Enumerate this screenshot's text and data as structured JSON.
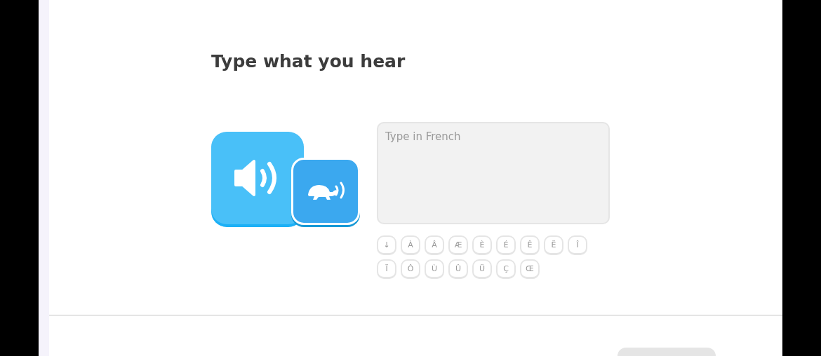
{
  "prompt": {
    "title": "Type what you hear"
  },
  "audio": {
    "normal_button": {
      "selected": false
    },
    "slow_button": {
      "selected": false
    }
  },
  "answer": {
    "placeholder": "Type in French"
  },
  "accent_keys": [
    [
      "↓",
      "À",
      "Â",
      "Æ",
      "È",
      "É",
      "Ê",
      "Ë",
      "Î"
    ],
    [
      "Ï",
      "Ô",
      "Ù",
      "Û",
      "Ü",
      "Ç",
      "Œ"
    ]
  ],
  "footer": {
    "check_button": {
      "disabled": true
    }
  }
}
